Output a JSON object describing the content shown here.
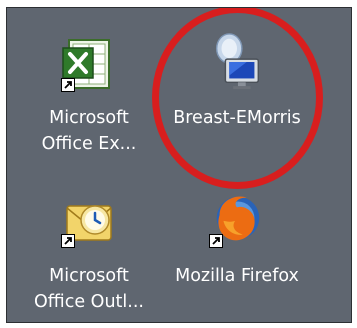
{
  "desktop": {
    "icons": [
      {
        "name": "Microsoft Excel",
        "label_line1": "Microsoft",
        "label_line2": "Office Ex...",
        "icon": "excel-icon",
        "shortcut": true
      },
      {
        "name": "Breast-EMorris",
        "label_line1": "Breast-EMorris",
        "label_line2": "",
        "icon": "remote-desktop-icon",
        "shortcut": false
      },
      {
        "name": "Microsoft Outlook",
        "label_line1": "Microsoft",
        "label_line2": "Office Outl...",
        "icon": "outlook-icon",
        "shortcut": true
      },
      {
        "name": "Mozilla Firefox",
        "label_line1": "Mozilla Firefox",
        "label_line2": "",
        "icon": "firefox-icon",
        "shortcut": true
      }
    ]
  },
  "colors": {
    "desktop_background": "#5f6670",
    "highlight_circle": "#d81e1e",
    "label_text": "#ffffff"
  }
}
